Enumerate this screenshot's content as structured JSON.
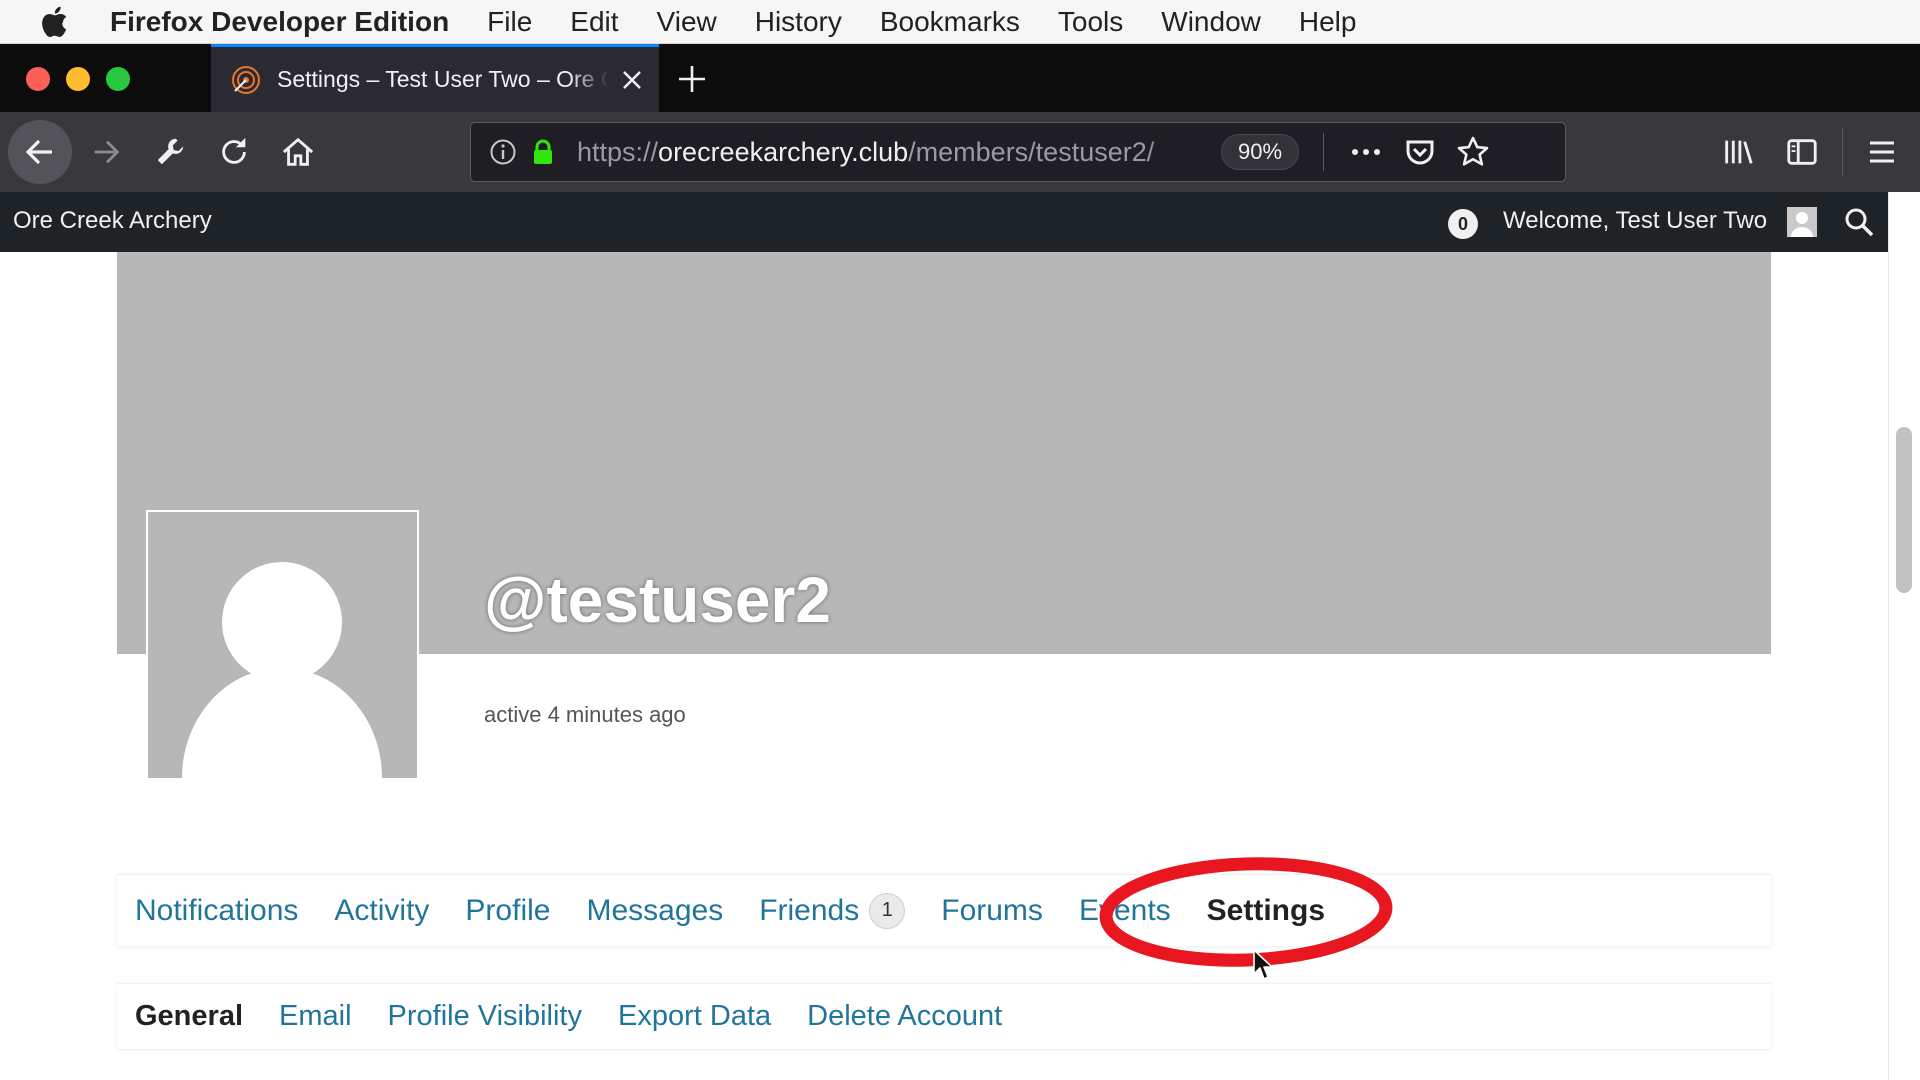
{
  "menubar": {
    "app_name": "Firefox Developer Edition",
    "items": [
      "File",
      "Edit",
      "View",
      "History",
      "Bookmarks",
      "Tools",
      "Window",
      "Help"
    ]
  },
  "browser": {
    "tab_title": "Settings – Test User Two – Ore Creek Archery",
    "url_scheme": "https://",
    "url_host": "orecreekarchery.club",
    "url_path": "/members/testuser2/",
    "zoom": "90%"
  },
  "adminbar": {
    "site_name": "Ore Creek Archery",
    "notification_count": "0",
    "welcome": "Welcome, Test User Two"
  },
  "profile": {
    "username": "@testuser2",
    "last_active": "active 4 minutes ago"
  },
  "primary_nav": {
    "notifications": "Notifications",
    "activity": "Activity",
    "profile": "Profile",
    "messages": "Messages",
    "friends": "Friends",
    "friends_count": "1",
    "forums": "Forums",
    "events": "Events",
    "settings": "Settings"
  },
  "settings_nav": {
    "general": "General",
    "email": "Email",
    "profile_visibility": "Profile Visibility",
    "export_data": "Export Data",
    "delete_account": "Delete Account"
  },
  "colors": {
    "link": "#21759b",
    "annotation": "#e8161e",
    "cover": "#b7b7b7"
  }
}
